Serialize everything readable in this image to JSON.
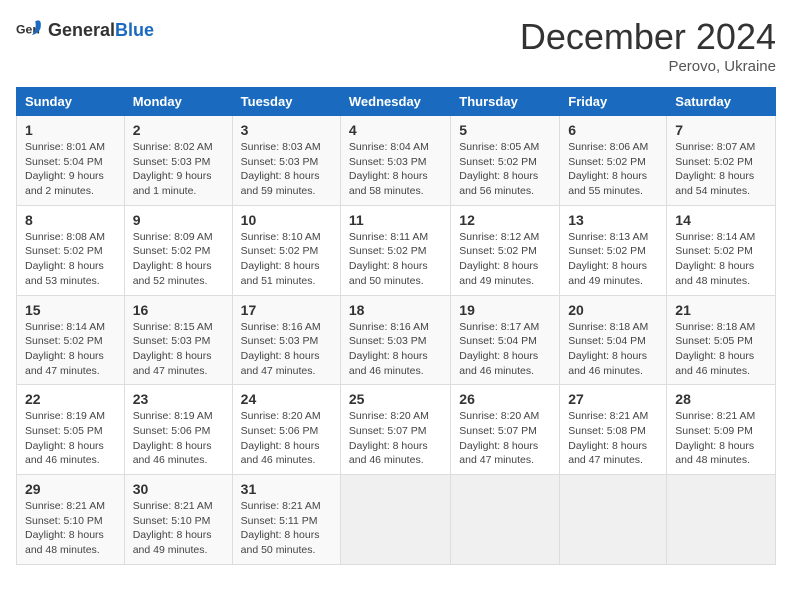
{
  "logo": {
    "general": "General",
    "blue": "Blue"
  },
  "header": {
    "month": "December 2024",
    "location": "Perovo, Ukraine"
  },
  "weekdays": [
    "Sunday",
    "Monday",
    "Tuesday",
    "Wednesday",
    "Thursday",
    "Friday",
    "Saturday"
  ],
  "weeks": [
    [
      {
        "day": "1",
        "sunrise": "Sunrise: 8:01 AM",
        "sunset": "Sunset: 5:04 PM",
        "daylight": "Daylight: 9 hours and 2 minutes."
      },
      {
        "day": "2",
        "sunrise": "Sunrise: 8:02 AM",
        "sunset": "Sunset: 5:03 PM",
        "daylight": "Daylight: 9 hours and 1 minute."
      },
      {
        "day": "3",
        "sunrise": "Sunrise: 8:03 AM",
        "sunset": "Sunset: 5:03 PM",
        "daylight": "Daylight: 8 hours and 59 minutes."
      },
      {
        "day": "4",
        "sunrise": "Sunrise: 8:04 AM",
        "sunset": "Sunset: 5:03 PM",
        "daylight": "Daylight: 8 hours and 58 minutes."
      },
      {
        "day": "5",
        "sunrise": "Sunrise: 8:05 AM",
        "sunset": "Sunset: 5:02 PM",
        "daylight": "Daylight: 8 hours and 56 minutes."
      },
      {
        "day": "6",
        "sunrise": "Sunrise: 8:06 AM",
        "sunset": "Sunset: 5:02 PM",
        "daylight": "Daylight: 8 hours and 55 minutes."
      },
      {
        "day": "7",
        "sunrise": "Sunrise: 8:07 AM",
        "sunset": "Sunset: 5:02 PM",
        "daylight": "Daylight: 8 hours and 54 minutes."
      }
    ],
    [
      {
        "day": "8",
        "sunrise": "Sunrise: 8:08 AM",
        "sunset": "Sunset: 5:02 PM",
        "daylight": "Daylight: 8 hours and 53 minutes."
      },
      {
        "day": "9",
        "sunrise": "Sunrise: 8:09 AM",
        "sunset": "Sunset: 5:02 PM",
        "daylight": "Daylight: 8 hours and 52 minutes."
      },
      {
        "day": "10",
        "sunrise": "Sunrise: 8:10 AM",
        "sunset": "Sunset: 5:02 PM",
        "daylight": "Daylight: 8 hours and 51 minutes."
      },
      {
        "day": "11",
        "sunrise": "Sunrise: 8:11 AM",
        "sunset": "Sunset: 5:02 PM",
        "daylight": "Daylight: 8 hours and 50 minutes."
      },
      {
        "day": "12",
        "sunrise": "Sunrise: 8:12 AM",
        "sunset": "Sunset: 5:02 PM",
        "daylight": "Daylight: 8 hours and 49 minutes."
      },
      {
        "day": "13",
        "sunrise": "Sunrise: 8:13 AM",
        "sunset": "Sunset: 5:02 PM",
        "daylight": "Daylight: 8 hours and 49 minutes."
      },
      {
        "day": "14",
        "sunrise": "Sunrise: 8:14 AM",
        "sunset": "Sunset: 5:02 PM",
        "daylight": "Daylight: 8 hours and 48 minutes."
      }
    ],
    [
      {
        "day": "15",
        "sunrise": "Sunrise: 8:14 AM",
        "sunset": "Sunset: 5:02 PM",
        "daylight": "Daylight: 8 hours and 47 minutes."
      },
      {
        "day": "16",
        "sunrise": "Sunrise: 8:15 AM",
        "sunset": "Sunset: 5:03 PM",
        "daylight": "Daylight: 8 hours and 47 minutes."
      },
      {
        "day": "17",
        "sunrise": "Sunrise: 8:16 AM",
        "sunset": "Sunset: 5:03 PM",
        "daylight": "Daylight: 8 hours and 47 minutes."
      },
      {
        "day": "18",
        "sunrise": "Sunrise: 8:16 AM",
        "sunset": "Sunset: 5:03 PM",
        "daylight": "Daylight: 8 hours and 46 minutes."
      },
      {
        "day": "19",
        "sunrise": "Sunrise: 8:17 AM",
        "sunset": "Sunset: 5:04 PM",
        "daylight": "Daylight: 8 hours and 46 minutes."
      },
      {
        "day": "20",
        "sunrise": "Sunrise: 8:18 AM",
        "sunset": "Sunset: 5:04 PM",
        "daylight": "Daylight: 8 hours and 46 minutes."
      },
      {
        "day": "21",
        "sunrise": "Sunrise: 8:18 AM",
        "sunset": "Sunset: 5:05 PM",
        "daylight": "Daylight: 8 hours and 46 minutes."
      }
    ],
    [
      {
        "day": "22",
        "sunrise": "Sunrise: 8:19 AM",
        "sunset": "Sunset: 5:05 PM",
        "daylight": "Daylight: 8 hours and 46 minutes."
      },
      {
        "day": "23",
        "sunrise": "Sunrise: 8:19 AM",
        "sunset": "Sunset: 5:06 PM",
        "daylight": "Daylight: 8 hours and 46 minutes."
      },
      {
        "day": "24",
        "sunrise": "Sunrise: 8:20 AM",
        "sunset": "Sunset: 5:06 PM",
        "daylight": "Daylight: 8 hours and 46 minutes."
      },
      {
        "day": "25",
        "sunrise": "Sunrise: 8:20 AM",
        "sunset": "Sunset: 5:07 PM",
        "daylight": "Daylight: 8 hours and 46 minutes."
      },
      {
        "day": "26",
        "sunrise": "Sunrise: 8:20 AM",
        "sunset": "Sunset: 5:07 PM",
        "daylight": "Daylight: 8 hours and 47 minutes."
      },
      {
        "day": "27",
        "sunrise": "Sunrise: 8:21 AM",
        "sunset": "Sunset: 5:08 PM",
        "daylight": "Daylight: 8 hours and 47 minutes."
      },
      {
        "day": "28",
        "sunrise": "Sunrise: 8:21 AM",
        "sunset": "Sunset: 5:09 PM",
        "daylight": "Daylight: 8 hours and 48 minutes."
      }
    ],
    [
      {
        "day": "29",
        "sunrise": "Sunrise: 8:21 AM",
        "sunset": "Sunset: 5:10 PM",
        "daylight": "Daylight: 8 hours and 48 minutes."
      },
      {
        "day": "30",
        "sunrise": "Sunrise: 8:21 AM",
        "sunset": "Sunset: 5:10 PM",
        "daylight": "Daylight: 8 hours and 49 minutes."
      },
      {
        "day": "31",
        "sunrise": "Sunrise: 8:21 AM",
        "sunset": "Sunset: 5:11 PM",
        "daylight": "Daylight: 8 hours and 50 minutes."
      },
      null,
      null,
      null,
      null
    ]
  ]
}
